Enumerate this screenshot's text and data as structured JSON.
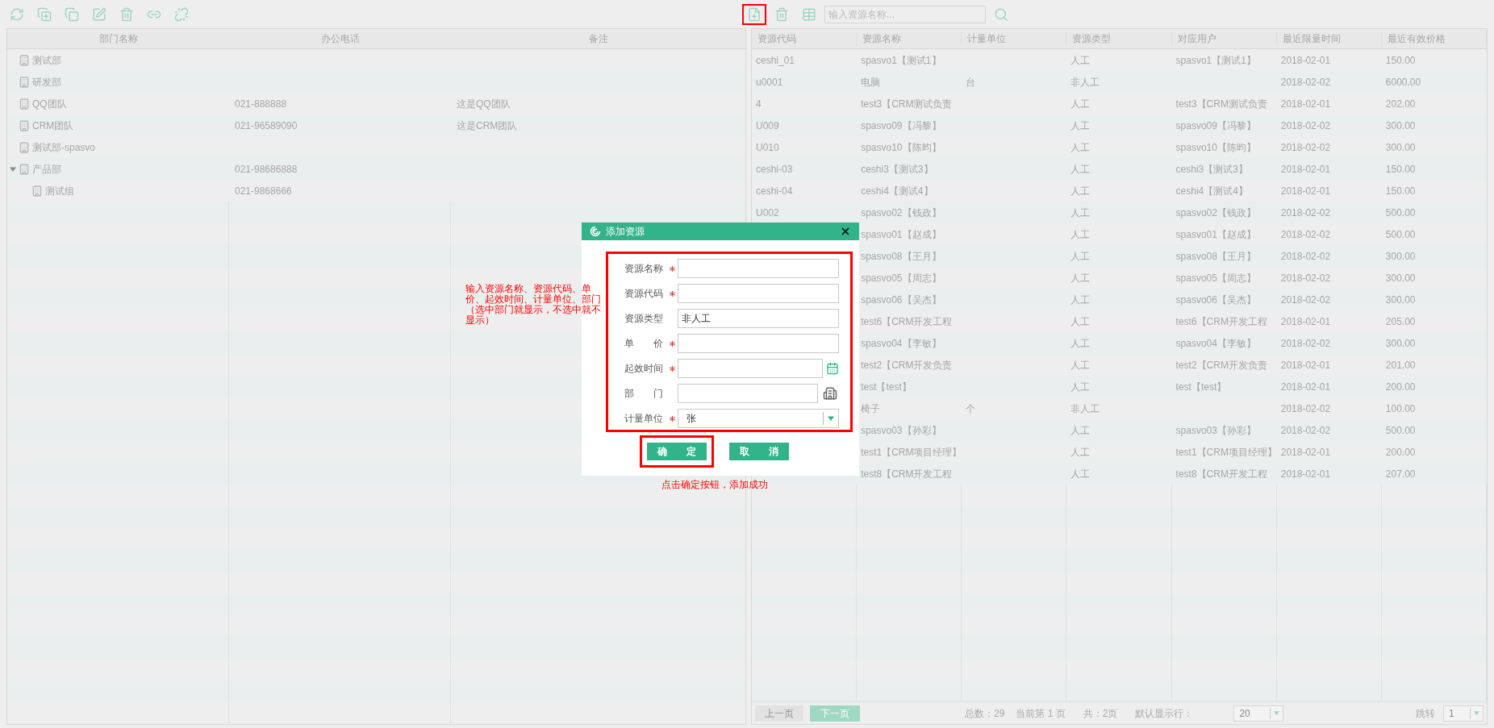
{
  "resource_toolbar": {
    "add_button": {
      "highlighted": true
    },
    "search": {
      "placeholder": "输入资源名称..."
    }
  },
  "departments": {
    "columns": [
      "部门名称",
      "办公电话",
      "备注"
    ],
    "rows": [
      {
        "name": "测试部"
      },
      {
        "name": "研发部"
      },
      {
        "name": "QQ团队",
        "phone": "021-888888",
        "note": "这是QQ团队"
      },
      {
        "name": "CRM团队",
        "phone": "021-96589090",
        "note": "这是CRM团队"
      },
      {
        "name": "测试部-spasvo"
      },
      {
        "name": "产品部",
        "phone": "021-98686888",
        "expanded": true,
        "children": [
          {
            "name": "测试组",
            "phone": "021-9868666"
          }
        ]
      }
    ]
  },
  "resources": {
    "columns": [
      "资源代码",
      "资源名称",
      "计量单位",
      "资源类型",
      "对应用户",
      "最近限量时间",
      "最近有效价格"
    ],
    "rows": [
      {
        "code": "ceshi_01",
        "name": "spasvo1【测试1】",
        "type": "人工",
        "user": "spasvo1【测试1】",
        "date": "2018-02-01",
        "price": "150.00"
      },
      {
        "code": "u0001",
        "name": "电脑",
        "unit": "台",
        "type": "非人工",
        "date": "2018-02-02",
        "price": "6000.00"
      },
      {
        "code": "4",
        "name": "test3【CRM测试负责",
        "type": "人工",
        "user": "test3【CRM测试负责",
        "date": "2018-02-01",
        "price": "202.00"
      },
      {
        "code": "U009",
        "name": "spasvo09【冯黎】",
        "type": "人工",
        "user": "spasvo09【冯黎】",
        "date": "2018-02-02",
        "price": "300.00"
      },
      {
        "code": "U010",
        "name": "spasvo10【陈昀】",
        "type": "人工",
        "user": "spasvo10【陈昀】",
        "date": "2018-02-02",
        "price": "300.00"
      },
      {
        "code": "ceshi-03",
        "name": "ceshi3【测试3】",
        "type": "人工",
        "user": "ceshi3【测试3】",
        "date": "2018-02-01",
        "price": "150.00"
      },
      {
        "code": "ceshi-04",
        "name": "ceshi4【测试4】",
        "type": "人工",
        "user": "ceshi4【测试4】",
        "date": "2018-02-01",
        "price": "150.00"
      },
      {
        "code": "U002",
        "name": "spasvo02【钱政】",
        "type": "人工",
        "user": "spasvo02【钱政】",
        "date": "2018-02-02",
        "price": "500.00"
      },
      {
        "name": "spasvo01【赵成】",
        "type": "人工",
        "user": "spasvo01【赵成】",
        "date": "2018-02-02",
        "price": "500.00"
      },
      {
        "name": "spasvo08【王月】",
        "type": "人工",
        "user": "spasvo08【王月】",
        "date": "2018-02-02",
        "price": "300.00"
      },
      {
        "name": "spasvo05【周志】",
        "type": "人工",
        "user": "spasvo05【周志】",
        "date": "2018-02-02",
        "price": "300.00"
      },
      {
        "name": "spasvo06【吴杰】",
        "type": "人工",
        "user": "spasvo06【吴杰】",
        "date": "2018-02-02",
        "price": "300.00"
      },
      {
        "name": "test6【CRM开发工程",
        "type": "人工",
        "user": "test6【CRM开发工程",
        "date": "2018-02-01",
        "price": "205.00"
      },
      {
        "name": "spasvo04【李敏】",
        "type": "人工",
        "user": "spasvo04【李敏】",
        "date": "2018-02-02",
        "price": "300.00"
      },
      {
        "name": "test2【CRM开发负责",
        "type": "人工",
        "user": "test2【CRM开发负责",
        "date": "2018-02-01",
        "price": "201.00"
      },
      {
        "name": "test【test】",
        "type": "人工",
        "user": "test【test】",
        "date": "2018-02-01",
        "price": "200.00"
      },
      {
        "name": "椅子",
        "unit": "个",
        "type": "非人工",
        "date": "2018-02-02",
        "price": "100.00"
      },
      {
        "name": "spasvo03【孙彩】",
        "type": "人工",
        "user": "spasvo03【孙彩】",
        "date": "2018-02-02",
        "price": "500.00"
      },
      {
        "name": "test1【CRM项目经理】",
        "type": "人工",
        "user": "test1【CRM项目经理】",
        "date": "2018-02-01",
        "price": "200.00"
      },
      {
        "name": "test8【CRM开发工程",
        "type": "人工",
        "user": "test8【CRM开发工程",
        "date": "2018-02-01",
        "price": "207.00"
      }
    ]
  },
  "pagination": {
    "prev": {
      "label": "上一页",
      "disabled": true
    },
    "next": {
      "label": "下一页",
      "disabled": false
    },
    "total": "总数：29",
    "current": "当前第 1 页",
    "pages": "共：2页",
    "rows_label": "默认显示行：",
    "rows_value": "20",
    "jump_label": "跳转",
    "jump_value": "1"
  },
  "dialog": {
    "title": "添加资源",
    "form_highlighted": true,
    "fields": [
      {
        "kind": "text",
        "label": "资源名称",
        "required": true
      },
      {
        "kind": "text",
        "label": "资源代码",
        "required": true
      },
      {
        "kind": "text",
        "label": "资源类型",
        "required": false,
        "value": "非人工"
      },
      {
        "kind": "text",
        "label": "单　　价",
        "required": true
      },
      {
        "kind": "date",
        "label": "起效时间",
        "required": true
      },
      {
        "kind": "department",
        "label": "部　　门",
        "required": false
      },
      {
        "kind": "select",
        "label": "计量单位",
        "required": true,
        "value": "张"
      }
    ],
    "buttons": [
      {
        "label": "确　　定",
        "highlighted": true
      },
      {
        "label": "取　　消",
        "highlighted": false
      }
    ]
  },
  "annotations": {
    "fields_note": "输入资源名称、资源代码、单价、起效时间、计量单位、部门（选中部门就显示，不选中就不显示）",
    "button_note": "点击确定按钮，添加成功"
  }
}
